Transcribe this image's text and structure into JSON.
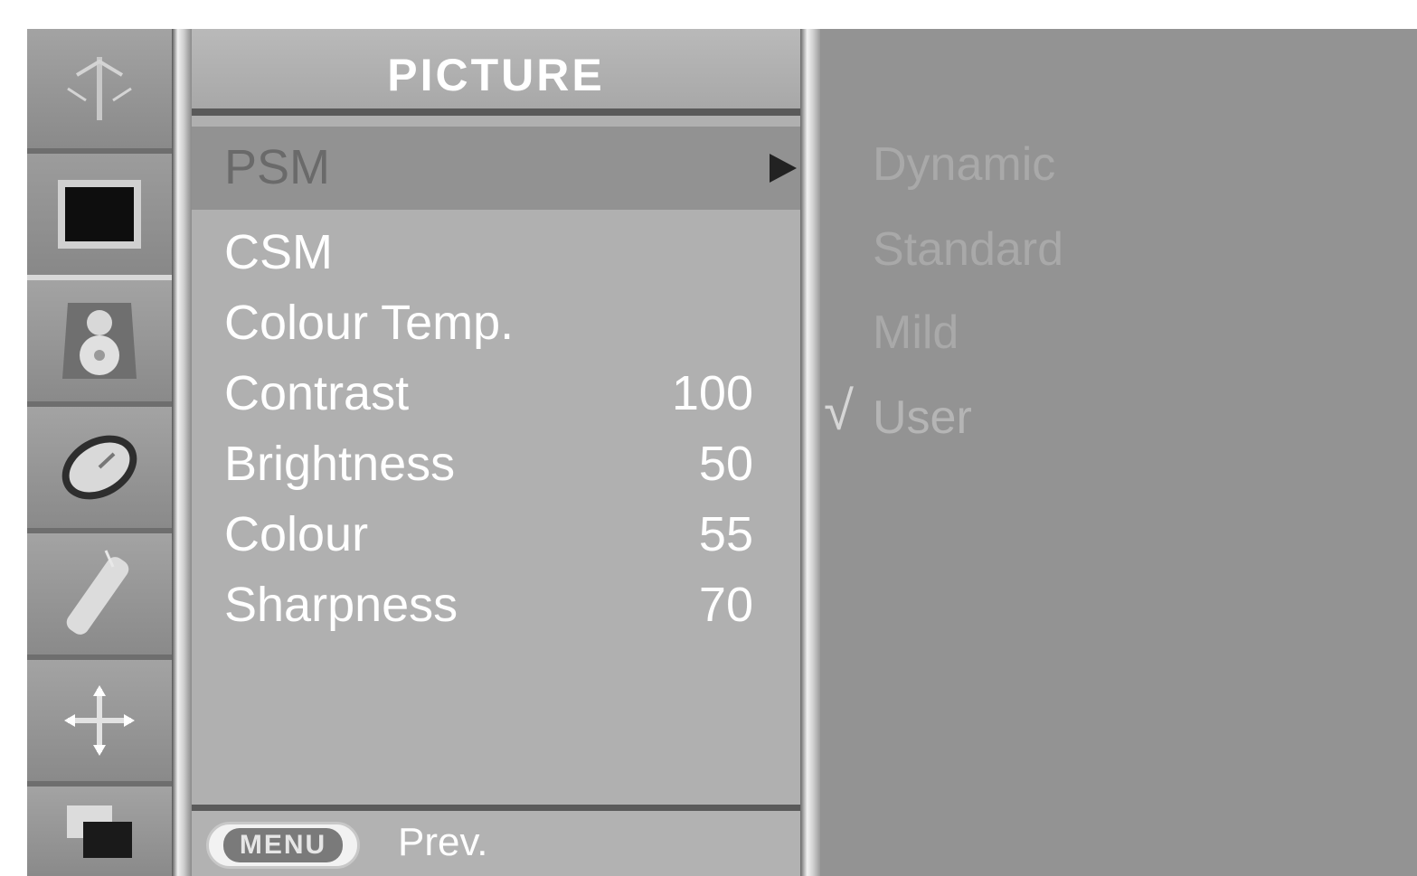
{
  "menu": {
    "title": "PICTURE",
    "items": [
      {
        "label": "PSM",
        "value": "",
        "selected": true,
        "has_submenu": true
      },
      {
        "label": "CSM",
        "value": ""
      },
      {
        "label": "Colour Temp.",
        "value": ""
      },
      {
        "label": "Contrast",
        "value": "100"
      },
      {
        "label": "Brightness",
        "value": "50"
      },
      {
        "label": "Colour",
        "value": "55"
      },
      {
        "label": "Sharpness",
        "value": "70"
      }
    ],
    "footer": {
      "button_label": "MENU",
      "prev_label": "Prev."
    }
  },
  "submenu": {
    "items": [
      {
        "label": "Dynamic",
        "checked": false
      },
      {
        "label": "Standard",
        "checked": false
      },
      {
        "label": "Mild",
        "checked": false
      },
      {
        "label": "User",
        "checked": true
      }
    ],
    "check_glyph": "√"
  },
  "sidebar": {
    "icons": [
      {
        "name": "station-antenna-icon",
        "active": false
      },
      {
        "name": "picture-screen-icon",
        "active": true
      },
      {
        "name": "sound-speaker-icon",
        "active": false
      },
      {
        "name": "time-clock-icon",
        "active": false
      },
      {
        "name": "special-remote-icon",
        "active": false
      },
      {
        "name": "screen-adjust-icon",
        "active": false
      },
      {
        "name": "pip-windows-icon",
        "active": false
      }
    ]
  },
  "colors": {
    "menu_bg": "#b0b0b0",
    "selected_row": "#929292",
    "submenu_bg": "#939393",
    "text": "#ffffff"
  }
}
